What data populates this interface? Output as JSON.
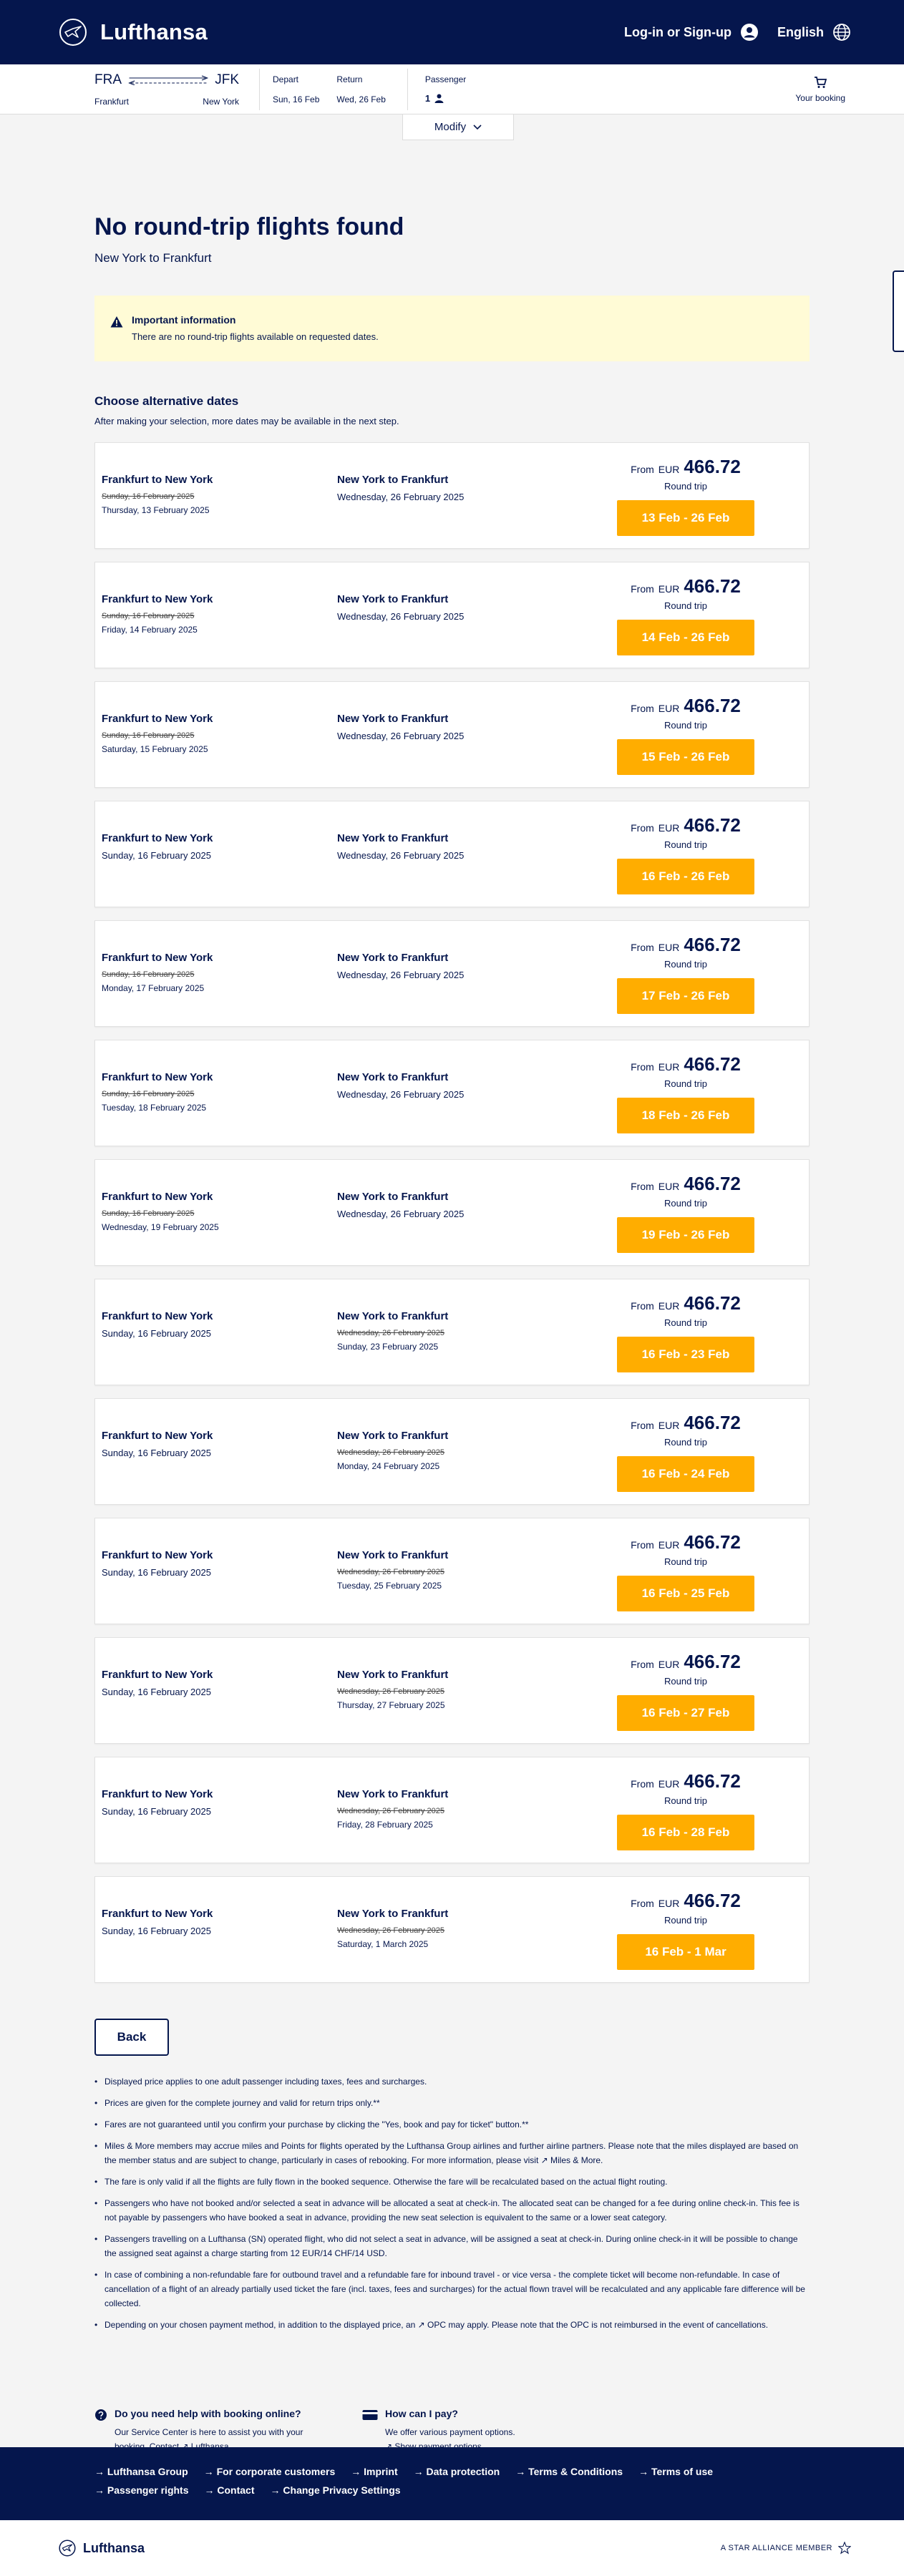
{
  "header": {
    "brand": "Lufthansa",
    "login": "Log-in or Sign-up",
    "language": "English"
  },
  "summary": {
    "origin_code": "FRA",
    "destination_code": "JFK",
    "origin_city": "Frankfurt",
    "destination_city": "New York",
    "depart_label": "Depart",
    "depart_date": "Sun, 16 Feb",
    "return_label": "Return",
    "return_date": "Wed, 26 Feb",
    "passenger_label": "Passenger",
    "passenger_count": "1",
    "booking_label": "Your booking",
    "modify_label": "Modify"
  },
  "page": {
    "title": "No round-trip flights found",
    "subtitle": "New York to Frankfurt"
  },
  "notice": {
    "title": "Important information",
    "text": "There are no round-trip flights available on requested dates."
  },
  "alternatives": {
    "title": "Choose alternative dates",
    "subtitle": "After making your selection, more dates may be available in the next step.",
    "price_prefix": "From",
    "currency": "EUR",
    "trip_type": "Round trip",
    "items": [
      {
        "out_title": "Frankfurt to New York",
        "out_old": "Sunday, 16 February 2025",
        "out_date": "Thursday, 13 February 2025",
        "in_title": "New York to Frankfurt",
        "in_old": "",
        "in_date": "Wednesday, 26 February 2025",
        "price": "466.72",
        "button": "13 Feb - 26 Feb"
      },
      {
        "out_title": "Frankfurt to New York",
        "out_old": "Sunday, 16 February 2025",
        "out_date": "Friday, 14 February 2025",
        "in_title": "New York to Frankfurt",
        "in_old": "",
        "in_date": "Wednesday, 26 February 2025",
        "price": "466.72",
        "button": "14 Feb - 26 Feb"
      },
      {
        "out_title": "Frankfurt to New York",
        "out_old": "Sunday, 16 February 2025",
        "out_date": "Saturday, 15 February 2025",
        "in_title": "New York to Frankfurt",
        "in_old": "",
        "in_date": "Wednesday, 26 February 2025",
        "price": "466.72",
        "button": "15 Feb - 26 Feb"
      },
      {
        "out_title": "Frankfurt to New York",
        "out_old": "",
        "out_date": "Sunday, 16 February 2025",
        "in_title": "New York to Frankfurt",
        "in_old": "",
        "in_date": "Wednesday, 26 February 2025",
        "price": "466.72",
        "button": "16 Feb - 26 Feb"
      },
      {
        "out_title": "Frankfurt to New York",
        "out_old": "Sunday, 16 February 2025",
        "out_date": "Monday, 17 February 2025",
        "in_title": "New York to Frankfurt",
        "in_old": "",
        "in_date": "Wednesday, 26 February 2025",
        "price": "466.72",
        "button": "17 Feb - 26 Feb"
      },
      {
        "out_title": "Frankfurt to New York",
        "out_old": "Sunday, 16 February 2025",
        "out_date": "Tuesday, 18 February 2025",
        "in_title": "New York to Frankfurt",
        "in_old": "",
        "in_date": "Wednesday, 26 February 2025",
        "price": "466.72",
        "button": "18 Feb - 26 Feb"
      },
      {
        "out_title": "Frankfurt to New York",
        "out_old": "Sunday, 16 February 2025",
        "out_date": "Wednesday, 19 February 2025",
        "in_title": "New York to Frankfurt",
        "in_old": "",
        "in_date": "Wednesday, 26 February 2025",
        "price": "466.72",
        "button": "19 Feb - 26 Feb"
      },
      {
        "out_title": "Frankfurt to New York",
        "out_old": "",
        "out_date": "Sunday, 16 February 2025",
        "in_title": "New York to Frankfurt",
        "in_old": "Wednesday, 26 February 2025",
        "in_date": "Sunday, 23 February 2025",
        "price": "466.72",
        "button": "16 Feb - 23 Feb"
      },
      {
        "out_title": "Frankfurt to New York",
        "out_old": "",
        "out_date": "Sunday, 16 February 2025",
        "in_title": "New York to Frankfurt",
        "in_old": "Wednesday, 26 February 2025",
        "in_date": "Monday, 24 February 2025",
        "price": "466.72",
        "button": "16 Feb - 24 Feb"
      },
      {
        "out_title": "Frankfurt to New York",
        "out_old": "",
        "out_date": "Sunday, 16 February 2025",
        "in_title": "New York to Frankfurt",
        "in_old": "Wednesday, 26 February 2025",
        "in_date": "Tuesday, 25 February 2025",
        "price": "466.72",
        "button": "16 Feb - 25 Feb"
      },
      {
        "out_title": "Frankfurt to New York",
        "out_old": "",
        "out_date": "Sunday, 16 February 2025",
        "in_title": "New York to Frankfurt",
        "in_old": "Wednesday, 26 February 2025",
        "in_date": "Thursday, 27 February 2025",
        "price": "466.72",
        "button": "16 Feb - 27 Feb"
      },
      {
        "out_title": "Frankfurt to New York",
        "out_old": "",
        "out_date": "Sunday, 16 February 2025",
        "in_title": "New York to Frankfurt",
        "in_old": "Wednesday, 26 February 2025",
        "in_date": "Friday, 28 February 2025",
        "price": "466.72",
        "button": "16 Feb - 28 Feb"
      },
      {
        "out_title": "Frankfurt to New York",
        "out_old": "",
        "out_date": "Sunday, 16 February 2025",
        "in_title": "New York to Frankfurt",
        "in_old": "Wednesday, 26 February 2025",
        "in_date": "Saturday, 1 March 2025",
        "price": "466.72",
        "button": "16 Feb - 1 Mar"
      }
    ]
  },
  "back_label": "Back",
  "notes": [
    "Displayed price applies to one adult passenger including taxes, fees and surcharges.",
    "Prices are given for the complete journey and valid for return trips only.**",
    "Fares are not guaranteed until you confirm your purchase by clicking the \"Yes, book and pay for ticket\" button.**",
    "Miles & More members may accrue miles and Points for flights operated by the Lufthansa Group airlines and further airline partners. Please note that the miles displayed are based on the member status and are subject to change, particularly in cases of rebooking. For more information, please visit ↗ Miles & More.",
    "The fare is only valid if all the flights are fully flown in the booked sequence. Otherwise the fare will be recalculated based on the actual flight routing.",
    "Passengers who have not booked and/or selected a seat in advance will be allocated a seat at check-in. The allocated seat can be changed for a fee during online check-in. This fee is not payable by passengers who have booked a seat in advance, providing the new seat selection is equivalent to the same or a lower seat category.",
    "Passengers travelling on a Lufthansa (SN) operated flight, who did not select a seat in advance, will be assigned a seat at check-in. During online check-in it will be possible to change the assigned seat against a charge starting from 12 EUR/14 CHF/14 USD.",
    "In case of combining a non-refundable fare for outbound travel and a refundable fare for inbound travel - or vice versa - the complete ticket will become non-refundable. In case of cancellation of a flight of an already partially used ticket the fare (incl. taxes, fees and surcharges) for the actual flown travel will be recalculated and any applicable fare difference will be collected.",
    "Depending on your chosen payment method, in addition to the displayed price, an ↗ OPC may apply. Please note that the OPC is not reimbursed in the event of cancellations."
  ],
  "help": {
    "booking_title": "Do you need help with booking online?",
    "booking_text": "Our Service Center is here to assist you with your booking. Contact",
    "booking_link": "↗ Lufthansa",
    "pay_title": "How can I pay?",
    "pay_text": "We offer various payment options.",
    "pay_link": "↗ Show payment options"
  },
  "footer": {
    "links": [
      "Lufthansa Group",
      "For corporate customers",
      "Imprint",
      "Data protection",
      "Terms & Conditions",
      "Terms of use",
      "Passenger rights",
      "Contact",
      "Change Privacy Settings"
    ],
    "brand": "Lufthansa",
    "alliance": "A STAR ALLIANCE MEMBER"
  }
}
